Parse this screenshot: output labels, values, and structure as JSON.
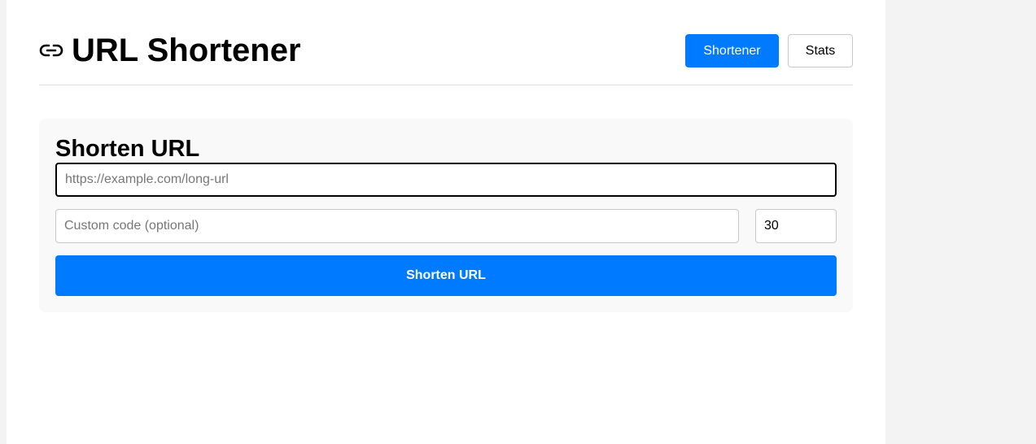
{
  "header": {
    "icon": "link-icon",
    "title": "URL Shortener"
  },
  "nav": {
    "items": [
      {
        "label": "Shortener",
        "active": true
      },
      {
        "label": "Stats",
        "active": false
      }
    ]
  },
  "form": {
    "title": "Shorten URL",
    "url_placeholder": "https://example.com/long-url",
    "url_value": "",
    "code_placeholder": "Custom code (optional)",
    "code_value": "",
    "days_value": "30",
    "submit_label": "Shorten URL"
  },
  "colors": {
    "accent": "#007bff",
    "card_bg": "#f9f9f9",
    "side_bg": "#f3f3f3"
  }
}
